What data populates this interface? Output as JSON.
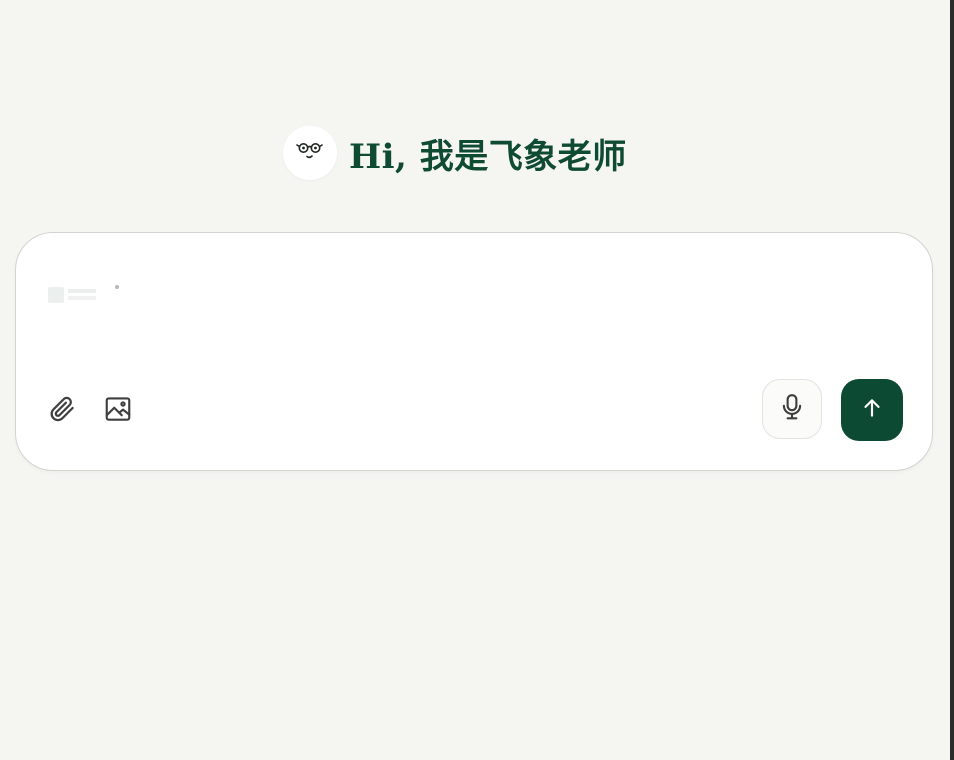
{
  "greeting": {
    "text": "Hi, 我是飞象老师",
    "avatar_icon": "teacher-face-icon"
  },
  "composer": {
    "input_value": "",
    "attach_icon": "paperclip-icon",
    "image_icon": "image-icon",
    "mic_icon": "microphone-icon",
    "send_icon": "arrow-up-icon"
  },
  "colors": {
    "background": "#f5f5f2",
    "brand_green": "#0d4a33",
    "composer_bg": "#ffffff",
    "border": "#d3d3cf"
  }
}
